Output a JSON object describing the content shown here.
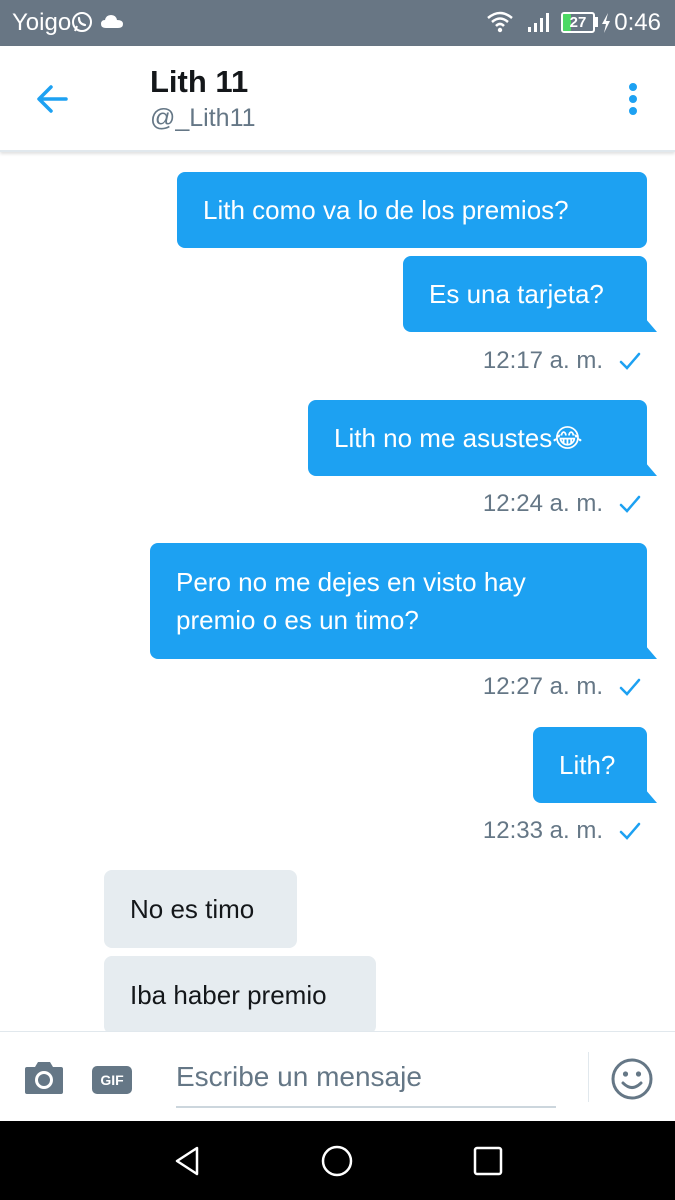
{
  "status_bar": {
    "carrier": "Yoigo",
    "battery": "27",
    "time": "0:46",
    "icons": [
      "whatsapp-icon",
      "cloud-icon",
      "wifi-icon",
      "signal-icon",
      "battery-icon",
      "charging-icon"
    ]
  },
  "header": {
    "name": "Lith 11",
    "handle": "@_Lith11",
    "icons": [
      "back-arrow-icon",
      "more-vertical-icon"
    ]
  },
  "messages": [
    {
      "direction": "out",
      "text": "Lith como va lo de los premios?"
    },
    {
      "direction": "out",
      "text": "Es una tarjeta?",
      "time": "12:17 a. m."
    },
    {
      "direction": "out",
      "text": "Lith no me asustes😂",
      "time": "12:24 a. m."
    },
    {
      "direction": "out",
      "lines": [
        "Pero no me dejes en visto hay",
        "premio o es un timo?"
      ],
      "time": "12:27 a. m."
    },
    {
      "direction": "out",
      "text": "Lith?",
      "time": "12:33 a. m."
    },
    {
      "direction": "in",
      "text": "No es timo"
    },
    {
      "direction": "in",
      "text": "Iba haber premio"
    }
  ],
  "composer": {
    "placeholder": "Escribe un mensaje",
    "gif_label": "GIF",
    "icons": [
      "camera-icon",
      "gif-icon",
      "emoji-icon"
    ]
  },
  "nav_bar": {
    "icons": [
      "back-triangle-icon",
      "home-circle-icon",
      "recents-square-icon"
    ]
  },
  "colors": {
    "accent": "#1da1f2",
    "status_bar": "#687684",
    "incoming_bubble": "#e6ecf0",
    "meta_text": "#657786"
  }
}
